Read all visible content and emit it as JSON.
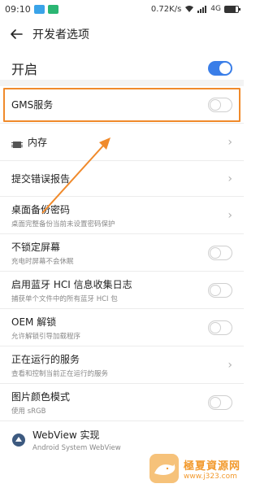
{
  "status_bar": {
    "time": "09:10",
    "speed": "0.72K/s",
    "signal_text": "4G",
    "battery_level": 0.8,
    "notif_colors": [
      "#3aa3e8",
      "#2bb673"
    ]
  },
  "header": {
    "title": "开发者选项"
  },
  "master": {
    "label": "开启",
    "enabled": true
  },
  "colors": {
    "accent": "#3a7ee8",
    "highlight": "#f08a2b"
  },
  "rows": [
    {
      "title": "GMS服务",
      "sub": "",
      "control": "toggle-off"
    },
    {
      "title": "内存",
      "sub": "",
      "control": "chevron"
    },
    {
      "title": "提交错误报告",
      "sub": "",
      "control": "chevron"
    },
    {
      "title": "桌面备份密码",
      "sub": "桌面完整备份当前未设置密码保护",
      "control": "chevron"
    },
    {
      "title": "不锁定屏幕",
      "sub": "充电时屏幕不会休眠",
      "control": "toggle-off"
    },
    {
      "title": "启用蓝牙 HCI 信息收集日志",
      "sub": "捕获单个文件中的所有蓝牙 HCI 包",
      "control": "toggle-off"
    },
    {
      "title": "OEM 解锁",
      "sub": "允许解锁引导加载程序",
      "control": "toggle-off"
    },
    {
      "title": "正在运行的服务",
      "sub": "查看和控制当前正在运行的服务",
      "control": "chevron"
    },
    {
      "title": "图片颜色模式",
      "sub": "使用 sRGB",
      "control": "toggle-off"
    },
    {
      "title": "WebView 实现",
      "sub": "Android System WebView",
      "control": "none"
    }
  ],
  "watermark": {
    "name": "極夏資源网",
    "url": "www.j323.com"
  }
}
